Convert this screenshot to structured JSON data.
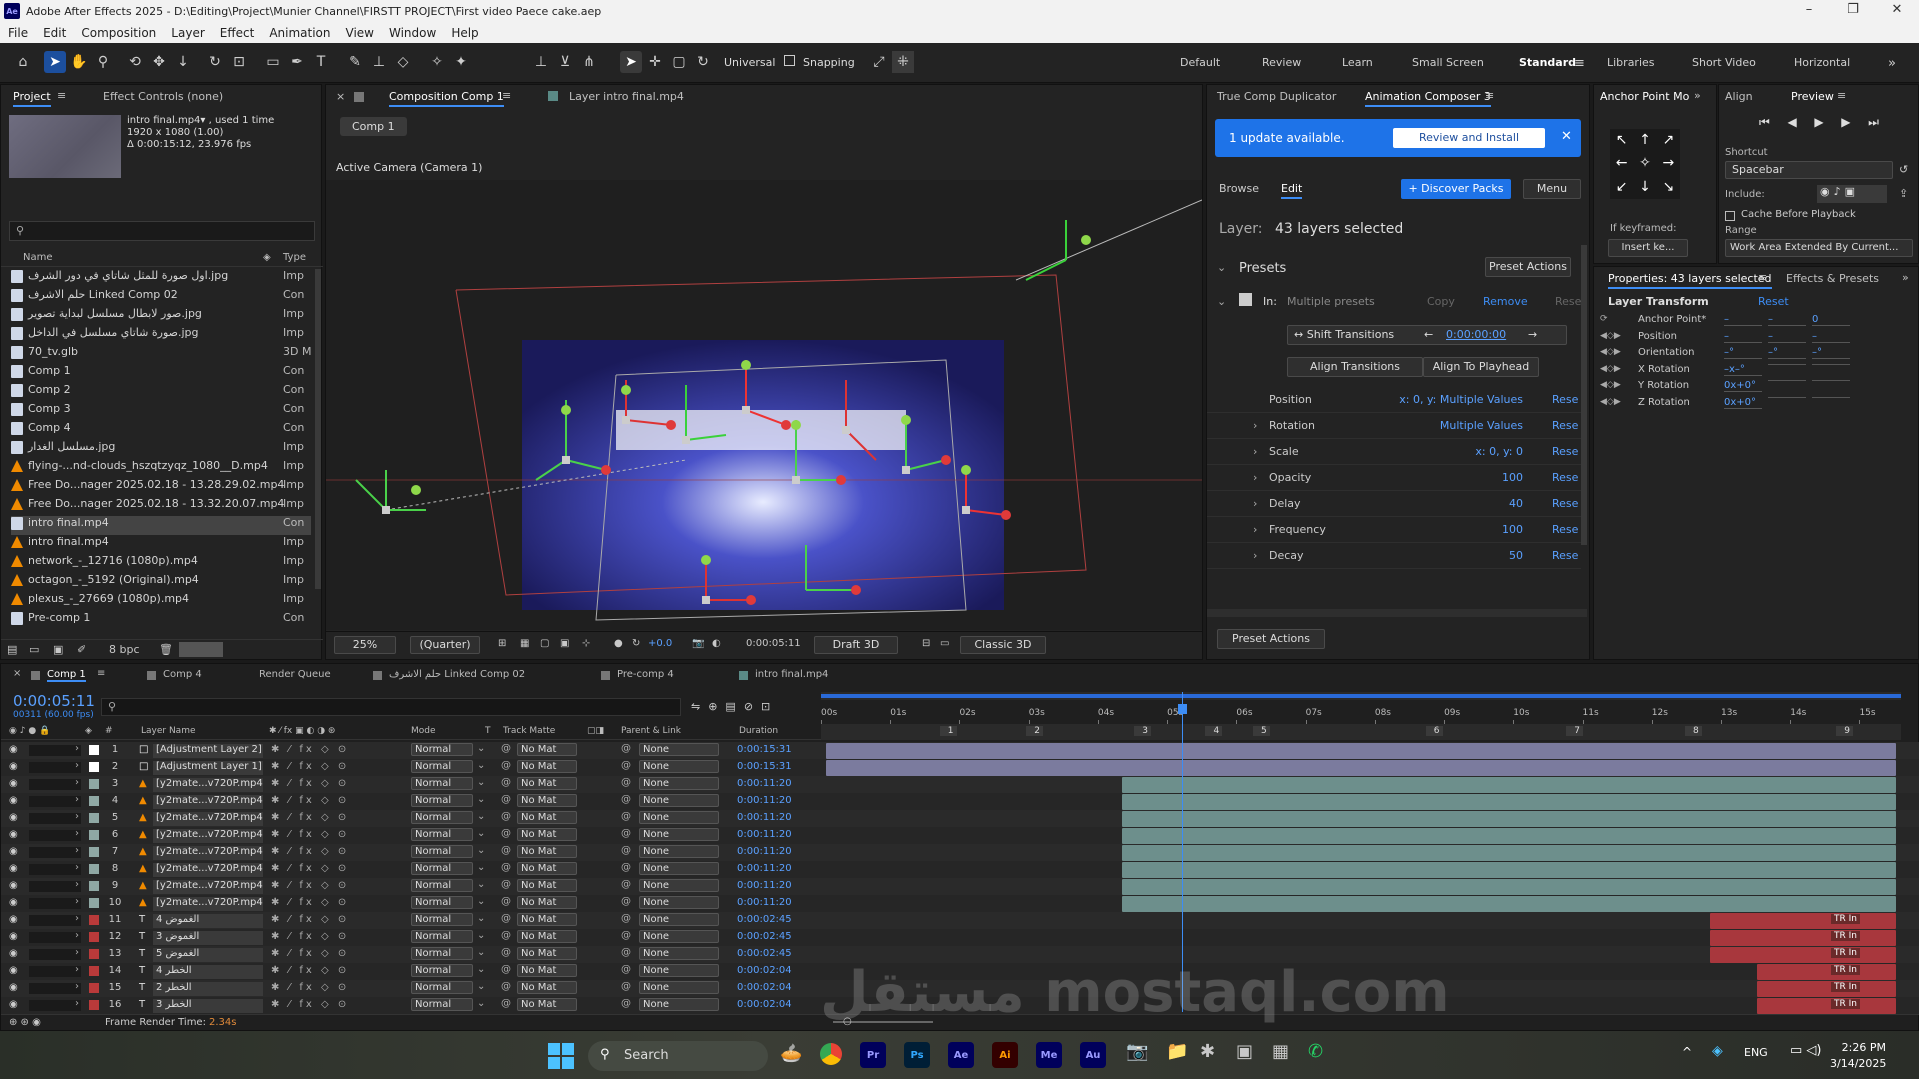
{
  "window": {
    "title": "Adobe After Effects 2025 - D:\\Editing\\Project\\Munier Channel\\FIRSTT PROJECT\\First video Paece cake.aep"
  },
  "menu": [
    "File",
    "Edit",
    "Composition",
    "Layer",
    "Effect",
    "Animation",
    "View",
    "Window",
    "Help"
  ],
  "toolbar": {
    "universal": "Universal",
    "snapping": "Snapping",
    "workspaces": [
      "Default",
      "Review",
      "Learn",
      "Small Screen",
      "Standard",
      "Libraries",
      "Short Video",
      "Horizontal"
    ]
  },
  "project": {
    "tabs": [
      "Project",
      "Effect Controls (none)"
    ],
    "preview_name": "intro final.mp4▾ , used 1 time",
    "preview_res": "1920 x 1080 (1.00)",
    "preview_dur": "Δ 0:00:15:12, 23.976 fps",
    "col_name": "Name",
    "col_type": "Type",
    "items": [
      {
        "name": "اول صورة للمثل شاتاي في دور الشرف.jpg",
        "type": "Imp",
        "kind": "img"
      },
      {
        "name": "حلم الاشرف Linked Comp 02",
        "type": "Con",
        "kind": "comp"
      },
      {
        "name": "صور لابطال مسلسل لبداية تصوير.jpg",
        "type": "Imp",
        "kind": "img"
      },
      {
        "name": "صورة شاتاي مسلسل في الداخل.jpg",
        "type": "Imp",
        "kind": "img"
      },
      {
        "name": "70_tv.glb",
        "type": "3D M",
        "kind": "img"
      },
      {
        "name": "Comp 1",
        "type": "Con",
        "kind": "comp"
      },
      {
        "name": "Comp 2",
        "type": "Con",
        "kind": "comp"
      },
      {
        "name": "Comp 3",
        "type": "Con",
        "kind": "comp"
      },
      {
        "name": "Comp 4",
        "type": "Con",
        "kind": "comp"
      },
      {
        "name": "مسلسل الغدار.jpg",
        "type": "Imp",
        "kind": "img"
      },
      {
        "name": "flying-...nd-clouds_hszqtzyqz_1080__D.mp4",
        "type": "Imp",
        "kind": "vid"
      },
      {
        "name": "Free Do...nager 2025.02.18 - 13.28.29.02.mp4",
        "type": "Imp",
        "kind": "vid"
      },
      {
        "name": "Free Do...nager 2025.02.18 - 13.32.20.07.mp4",
        "type": "Imp",
        "kind": "vid"
      },
      {
        "name": "intro final.mp4",
        "type": "Con",
        "kind": "comp"
      },
      {
        "name": "intro final.mp4",
        "type": "Imp",
        "kind": "vid"
      },
      {
        "name": "network_-_12716 (1080p).mp4",
        "type": "Imp",
        "kind": "vid"
      },
      {
        "name": "octagon_-_5192 (Original).mp4",
        "type": "Imp",
        "kind": "vid"
      },
      {
        "name": "plexus_-_27669 (1080p).mp4",
        "type": "Imp",
        "kind": "vid"
      },
      {
        "name": "Pre-comp 1",
        "type": "Con",
        "kind": "comp"
      }
    ],
    "bpc": "8 bpc"
  },
  "composition": {
    "tab": "Composition Comp 1",
    "layer_tab": "Layer intro final.mp4",
    "breadcrumb": "Comp 1",
    "camera": "Active Camera (Camera 1)",
    "zoom": "25%",
    "quality": "(Quarter)",
    "exposure": "+0.0",
    "timecode": "0:00:05:11",
    "draft": "Draft 3D",
    "renderer": "Classic 3D"
  },
  "composer": {
    "tabs": [
      "True Comp Duplicator",
      "Animation Composer 3"
    ],
    "update_text": "1 update available.",
    "update_btn": "Review and Install",
    "browse": "Browse",
    "edit": "Edit",
    "discover": "+ Discover Packs",
    "menu": "Menu",
    "layer_label": "Layer:",
    "layer_value": "43 layers selected",
    "presets": "Presets",
    "preset_actions": "Preset Actions",
    "in_label": "In:",
    "in_value": "Multiple presets",
    "copy": "Copy",
    "remove": "Remove",
    "reset": "Rese",
    "shift": "Shift Transitions",
    "shift_time": "0:00:00:00",
    "align": "Align Transitions",
    "align_playhead": "Align To Playhead",
    "props": [
      {
        "name": "Position",
        "value": "x: 0, y: Multiple Values"
      },
      {
        "name": "Rotation",
        "value": "Multiple Values"
      },
      {
        "name": "Scale",
        "value": "x: 0, y: 0"
      },
      {
        "name": "Opacity",
        "value": "100"
      },
      {
        "name": "Delay",
        "value": "40"
      },
      {
        "name": "Frequency",
        "value": "100"
      },
      {
        "name": "Decay",
        "value": "50"
      }
    ],
    "footer_btn": "Preset Actions"
  },
  "anchor_panel": {
    "tabs": [
      "Anchor Point Mo",
      "Align"
    ],
    "if_keyframed": "If keyframed:",
    "insert": "Insert ke..."
  },
  "preview_panel": {
    "title": "Preview",
    "shortcut_label": "Shortcut",
    "shortcut": "Spacebar",
    "include": "Include:",
    "cache": "Cache Before Playback",
    "range_label": "Range",
    "range": "Work Area Extended By Current..."
  },
  "properties": {
    "tabs": [
      "Properties: 43 layers selected",
      "Effects & Presets"
    ],
    "section": "Layer Transform",
    "reset": "Reset",
    "rows": [
      {
        "name": "Anchor Point*",
        "v1": "–",
        "v2": "–",
        "v3": "0"
      },
      {
        "name": "Position",
        "v1": "–",
        "v2": "–",
        "v3": "–"
      },
      {
        "name": "Orientation",
        "v1": "–°",
        "v2": "–°",
        "v3": "–°"
      },
      {
        "name": "X Rotation",
        "v1": "–x–°",
        "v2": "",
        "v3": ""
      },
      {
        "name": "Y Rotation",
        "v1": "0x+0°",
        "v2": "",
        "v3": ""
      },
      {
        "name": "Z Rotation",
        "v1": "0x+0°",
        "v2": "",
        "v3": ""
      }
    ]
  },
  "timeline": {
    "tabs": [
      "Comp 1",
      "Comp 4",
      "Render Queue",
      "حلم الاشرف Linked Comp 02",
      "Pre-comp 4",
      "intro final.mp4"
    ],
    "timecode": "0:00:05:11",
    "frames": "00311 (60.00 fps)",
    "columns": {
      "layer": "Layer Name",
      "mode": "Mode",
      "t": "T",
      "matte": "Track Matte",
      "parent": "Parent & Link",
      "duration": "Duration"
    },
    "ruler": [
      "00s",
      "01s",
      "02s",
      "03s",
      "04s",
      "05s",
      "06s",
      "07s",
      "08s",
      "09s",
      "10s",
      "11s",
      "12s",
      "13s",
      "14s",
      "15s"
    ],
    "markers": [
      "1",
      "2",
      "3",
      "4",
      "5",
      "6",
      "7",
      "8",
      "9"
    ],
    "mode": "Normal",
    "matte": "No Mat",
    "parent": "None",
    "layers": [
      {
        "n": "1",
        "name": "[Adjustment Layer 2]",
        "dur": "0:00:15:31",
        "color": "#ffffff",
        "type": "adj",
        "start": 0.0,
        "end": 1.0,
        "bar": "#7b7b9e"
      },
      {
        "n": "2",
        "name": "[Adjustment Layer 1]",
        "dur": "0:00:15:31",
        "color": "#ffffff",
        "type": "adj",
        "start": 0.0,
        "end": 1.0,
        "bar": "#7b7b9e"
      },
      {
        "n": "3",
        "name": "[y2mate...v720P.mp4]",
        "dur": "0:00:11:20",
        "color": "#8fa8a4",
        "type": "vid",
        "start": 0.277,
        "end": 1.0,
        "bar": "#6d8f8c"
      },
      {
        "n": "4",
        "name": "[y2mate...v720P.mp4]",
        "dur": "0:00:11:20",
        "color": "#8fa8a4",
        "type": "vid",
        "start": 0.277,
        "end": 1.0,
        "bar": "#6d8f8c"
      },
      {
        "n": "5",
        "name": "[y2mate...v720P.mp4]",
        "dur": "0:00:11:20",
        "color": "#8fa8a4",
        "type": "vid",
        "start": 0.277,
        "end": 1.0,
        "bar": "#6d8f8c"
      },
      {
        "n": "6",
        "name": "[y2mate...v720P.mp4]",
        "dur": "0:00:11:20",
        "color": "#8fa8a4",
        "type": "vid",
        "start": 0.277,
        "end": 1.0,
        "bar": "#6d8f8c"
      },
      {
        "n": "7",
        "name": "[y2mate...v720P.mp4]",
        "dur": "0:00:11:20",
        "color": "#8fa8a4",
        "type": "vid",
        "start": 0.277,
        "end": 1.0,
        "bar": "#6d8f8c"
      },
      {
        "n": "8",
        "name": "[y2mate...v720P.mp4]",
        "dur": "0:00:11:20",
        "color": "#8fa8a4",
        "type": "vid",
        "start": 0.277,
        "end": 1.0,
        "bar": "#6d8f8c"
      },
      {
        "n": "9",
        "name": "[y2mate...v720P.mp4]",
        "dur": "0:00:11:20",
        "color": "#8fa8a4",
        "type": "vid",
        "start": 0.277,
        "end": 1.0,
        "bar": "#6d8f8c"
      },
      {
        "n": "10",
        "name": "[y2mate...v720P.mp4]",
        "dur": "0:00:11:20",
        "color": "#8fa8a4",
        "type": "vid",
        "start": 0.277,
        "end": 1.0,
        "bar": "#6d8f8c"
      },
      {
        "n": "11",
        "name": "الغموض 4",
        "dur": "0:00:02:45",
        "color": "#b93a3a",
        "type": "text",
        "start": 0.826,
        "end": 1.0,
        "bar": "#a8373d",
        "tag": "TR In"
      },
      {
        "n": "12",
        "name": "الغموض 3",
        "dur": "0:00:02:45",
        "color": "#b93a3a",
        "type": "text",
        "start": 0.826,
        "end": 1.0,
        "bar": "#a8373d",
        "tag": "TR In"
      },
      {
        "n": "13",
        "name": "الغموض 5",
        "dur": "0:00:02:45",
        "color": "#b93a3a",
        "type": "text",
        "start": 0.826,
        "end": 1.0,
        "bar": "#a8373d",
        "tag": "TR In"
      },
      {
        "n": "14",
        "name": "الخطر 4",
        "dur": "0:00:02:04",
        "color": "#b93a3a",
        "type": "text",
        "start": 0.87,
        "end": 1.0,
        "bar": "#a8373d",
        "tag": "TR In"
      },
      {
        "n": "15",
        "name": "الخطر 2",
        "dur": "0:00:02:04",
        "color": "#b93a3a",
        "type": "text",
        "start": 0.87,
        "end": 1.0,
        "bar": "#a8373d",
        "tag": "TR In"
      },
      {
        "n": "16",
        "name": "الخطر 3",
        "dur": "0:00:02:04",
        "color": "#b93a3a",
        "type": "text",
        "start": 0.87,
        "end": 1.0,
        "bar": "#a8373d",
        "tag": "TR In"
      }
    ],
    "render_label": "Frame Render Time:",
    "render_time": "2.34s"
  },
  "taskbar": {
    "search": "Search",
    "lang": "ENG",
    "time": "2:26 PM",
    "date": "3/14/2025",
    "apps": [
      {
        "label": "Pr",
        "bg": "#00005b",
        "fg": "#9999ff"
      },
      {
        "label": "Ps",
        "bg": "#001e36",
        "fg": "#31a8ff"
      },
      {
        "label": "Ae",
        "bg": "#00005b",
        "fg": "#9999ff"
      },
      {
        "label": "Ai",
        "bg": "#330000",
        "fg": "#ff9a00"
      },
      {
        "label": "Me",
        "bg": "#00005b",
        "fg": "#9999ff"
      },
      {
        "label": "Au",
        "bg": "#00005b",
        "fg": "#9999ff"
      }
    ]
  },
  "watermark": "مستقل mostaql.com"
}
